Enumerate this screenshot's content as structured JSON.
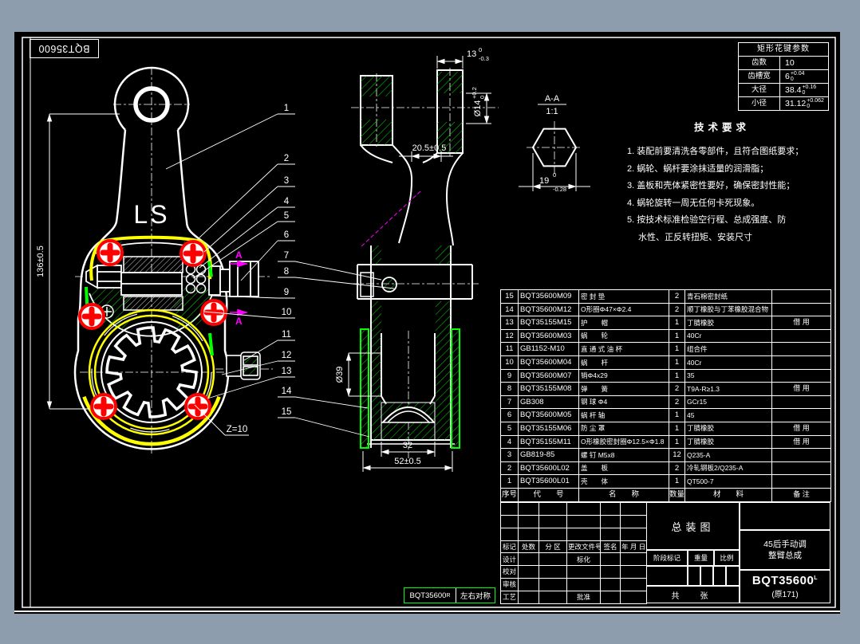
{
  "colors": {
    "background": "#8d9dae",
    "canvas": "#000000",
    "line": "#ffffff",
    "accent_yellow": "#ffff00",
    "accent_red": "#ff0000",
    "accent_green": "#00ff00",
    "accent_magenta": "#ff00ff"
  },
  "corner_stamp": {
    "code": "BQT35600"
  },
  "spline_table": {
    "title": "矩形花键参数",
    "rows": [
      {
        "label": "齿数",
        "value": "10",
        "upper": "",
        "lower": ""
      },
      {
        "label": "齿槽宽",
        "value": "6",
        "upper": "+0.04",
        "lower": "0"
      },
      {
        "label": "大径",
        "value": "38.4",
        "upper": "+0.16",
        "lower": "0"
      },
      {
        "label": "小径",
        "value": "31.12",
        "upper": "+0.062",
        "lower": "0"
      }
    ]
  },
  "tech_requirements": {
    "title": "技术要求",
    "lines": [
      {
        "t": "1. 装配前要清洗各零部件，且符合图纸要求；"
      },
      {
        "t": "2. 蜗轮、蜗杆要涂抹适量的润滑脂；"
      },
      {
        "t": "3. 盖板和壳体紧密性要好，确保密封性能；"
      },
      {
        "t": "4. 蜗轮旋转一周无任何卡死现象。"
      },
      {
        "t": "5. 按技术标准检验空行程、总成强度、防"
      },
      {
        "t": "　  水性、正反转扭矩、安装尺寸"
      }
    ]
  },
  "bom": {
    "header": {
      "no": "序号",
      "code": "代　　号",
      "name": "名　　称",
      "qty": "数量",
      "material": "材　　料",
      "remark": "备 注"
    },
    "rows": [
      {
        "no": "15",
        "code": "BQT35600M09",
        "name": "密  封  垫",
        "qty": "2",
        "material": "青石棉密封纸",
        "remark": ""
      },
      {
        "no": "14",
        "code": "BQT35600M12",
        "name": "O形圈Φ47×Φ2.4",
        "qty": "2",
        "material": "顺丁橡胶与丁苯橡胶混合物",
        "remark": ""
      },
      {
        "no": "13",
        "code": "BQT35155M15",
        "name": "护　　帽",
        "qty": "1",
        "material": "丁腈橡胶",
        "remark": "借 用"
      },
      {
        "no": "12",
        "code": "BQT35600M03",
        "name": "蜗　　轮",
        "qty": "1",
        "material": "40Cr",
        "remark": ""
      },
      {
        "no": "11",
        "code": "GB1152-M10",
        "name": "直 通 式 油 杯",
        "qty": "1",
        "material": "组合件",
        "remark": ""
      },
      {
        "no": "10",
        "code": "BQT35600M04",
        "name": "蜗　　杆",
        "qty": "1",
        "material": "40Cr",
        "remark": ""
      },
      {
        "no": "9",
        "code": "BQT35600M07",
        "name": "销Φ4x29",
        "qty": "1",
        "material": "35",
        "remark": ""
      },
      {
        "no": "8",
        "code": "BQT35155M08",
        "name": "弹　　簧",
        "qty": "2",
        "material": "T9A-R≥1.3",
        "remark": "借 用"
      },
      {
        "no": "7",
        "code": "GB308",
        "name": "钢  球  Φ4",
        "qty": "2",
        "material": "GCr15",
        "remark": ""
      },
      {
        "no": "6",
        "code": "BQT35600M05",
        "name": "蜗 杆 轴",
        "qty": "1",
        "material": "45",
        "remark": ""
      },
      {
        "no": "5",
        "code": "BQT35155M06",
        "name": "防 尘 罩",
        "qty": "1",
        "material": "丁腈橡胶",
        "remark": "借 用"
      },
      {
        "no": "4",
        "code": "BQT35155M11",
        "name": "O形橡胶密封圈Φ12.5×Φ1.8",
        "qty": "1",
        "material": "丁腈橡胶",
        "remark": "借 用"
      },
      {
        "no": "3",
        "code": "GB819-85",
        "name": "螺  钉  M5x8",
        "qty": "12",
        "material": "Q235-A",
        "remark": ""
      },
      {
        "no": "2",
        "code": "BQT35600L02",
        "name": "盖　　板",
        "qty": "2",
        "material": "冷轧钢板2/Q235-A",
        "remark": ""
      },
      {
        "no": "1",
        "code": "BQT35600L01",
        "name": "壳　　体",
        "qty": "1",
        "material": "QT500-7",
        "remark": ""
      }
    ]
  },
  "title_block": {
    "revision_rows": [
      {
        "a": "",
        "b": "",
        "c": "",
        "d": "",
        "e": "",
        "f": ""
      },
      {
        "a": "",
        "b": "",
        "c": "",
        "d": "",
        "e": "",
        "f": ""
      },
      {
        "a": "",
        "b": "",
        "c": "",
        "d": "",
        "e": "",
        "f": ""
      },
      {
        "a": "标记",
        "b": "处数",
        "c": "分 区",
        "d": "更改文件号",
        "e": "签名",
        "f": "年 月 日"
      },
      {
        "a": "设计",
        "b": "",
        "c": "",
        "d": "标化",
        "e": "",
        "f": ""
      },
      {
        "a": "校对",
        "b": "",
        "c": "",
        "d": "",
        "e": "",
        "f": ""
      },
      {
        "a": "审核",
        "b": "",
        "c": "",
        "d": "",
        "e": "",
        "f": ""
      },
      {
        "a": "工艺",
        "b": "",
        "c": "",
        "d": "批准",
        "e": "",
        "f": ""
      }
    ],
    "assembly_label": "总装图",
    "stage_label": "阶段标记",
    "weight_label": "重量",
    "scale_label": "比例",
    "sheet_label": "共　张",
    "product_name_line1": "45后手动调",
    "product_name_line2": "整臂总成",
    "drawing_no": "BQT35600",
    "drawing_no_suffix": "L",
    "origin_note": "(原171)"
  },
  "bottom_stamp": {
    "code": "BQT35600",
    "suffix": "R",
    "note": "左右对称"
  },
  "drawing": {
    "ls_mark": "LS",
    "z_label": "Z=10",
    "section_label": "A",
    "view_label": "A-A",
    "view_scale": "1:1",
    "dims": {
      "d136": "136±0.5",
      "d13": {
        "v": "13",
        "u": "0",
        "l": "-0.3"
      },
      "d14": {
        "v": "Ø14",
        "u": "+0.2",
        "l": "0"
      },
      "d205": "20.5±0.5",
      "d19": {
        "v": "19",
        "u": "0",
        "l": "-0.28"
      },
      "d39": "Ø39",
      "d32": "32",
      "d52": "52±0.5"
    },
    "parts": [
      "1",
      "2",
      "3",
      "4",
      "5",
      "6",
      "7",
      "8",
      "9",
      "10",
      "11",
      "12",
      "13",
      "14",
      "15"
    ]
  }
}
